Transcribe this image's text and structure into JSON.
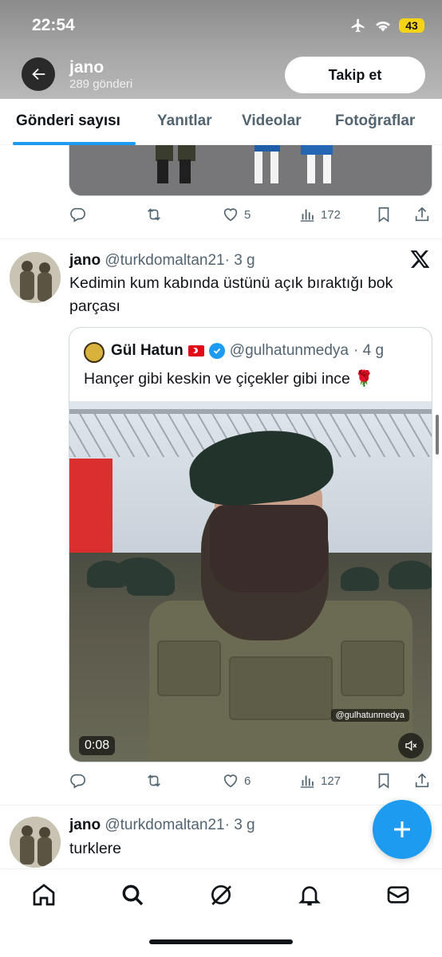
{
  "status": {
    "time": "22:54",
    "battery": "43"
  },
  "header": {
    "name": "jano",
    "post_count": "289 gönderi",
    "follow_label": "Takip et"
  },
  "tabs": [
    {
      "label": "Gönderi sayısı"
    },
    {
      "label": "Yanıtlar"
    },
    {
      "label": "Videolar"
    },
    {
      "label": "Fotoğraflar"
    }
  ],
  "tweets": [
    {
      "likes": "5",
      "views": "172"
    },
    {
      "name": "jano",
      "handle": "@turkdomaltan21",
      "time": "· 3 g",
      "text": "Kedimin kum kabında üstünü açık bıraktığı bok parçası",
      "quote": {
        "name": "Gül Hatun",
        "handle": "@gulhatunmedya",
        "time": "· 4 g",
        "text": "Hançer gibi keskin ve çiçekler gibi ince 🌹",
        "watermark": "@gulhatunmedya",
        "video_time": "0:08"
      },
      "likes": "6",
      "views": "127"
    },
    {
      "name": "jano",
      "handle": "@turkdomaltan21",
      "time": "· 3 g",
      "text": "turklere"
    }
  ],
  "colors": {
    "accent": "#1d9bf0",
    "secondary_text": "#536471"
  }
}
